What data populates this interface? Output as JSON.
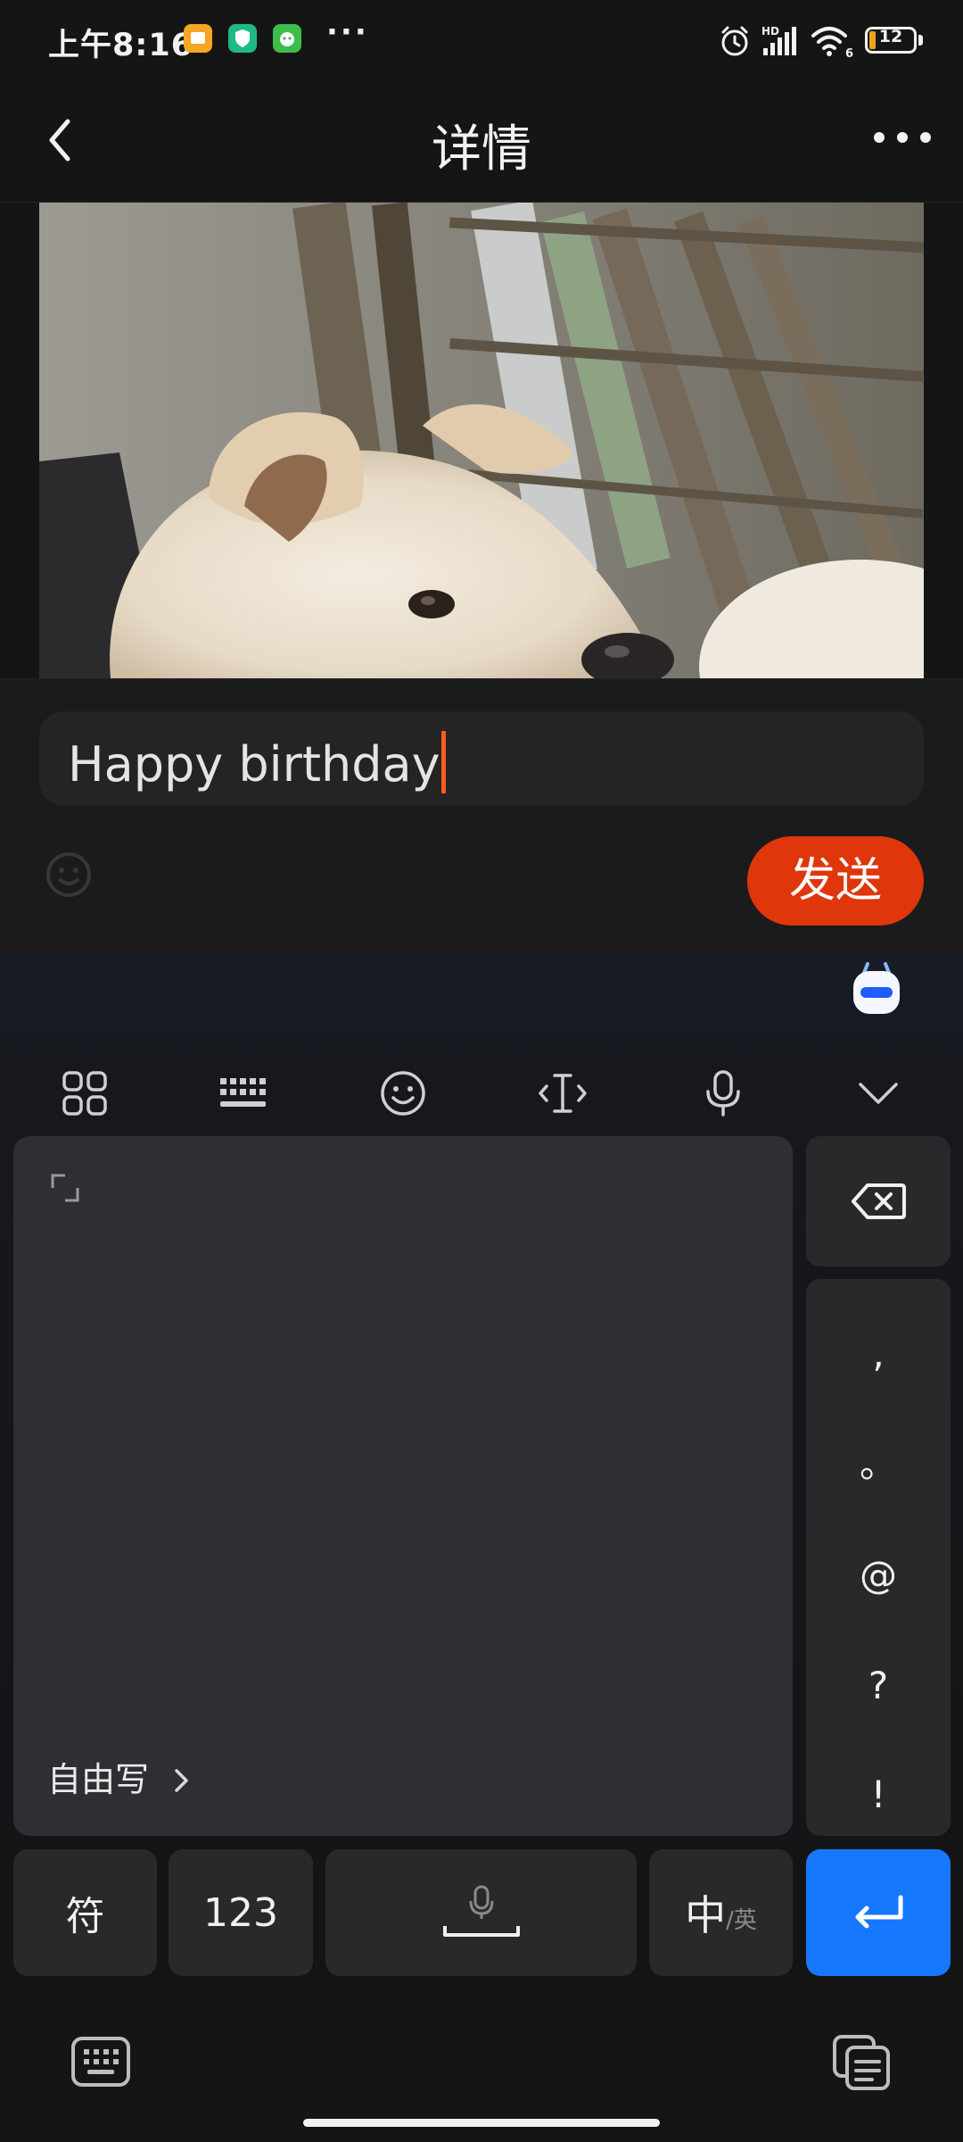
{
  "status_bar": {
    "time": "上午8:16",
    "more": "···",
    "battery": "12",
    "network_badge": "HD",
    "wifi_badge": "6"
  },
  "header": {
    "title": "详情"
  },
  "comment": {
    "input_value": "Happy birthday",
    "send_label": "发送"
  },
  "keyboard": {
    "freewrite_label": "自由写",
    "punctuation": [
      ",",
      "。",
      "@",
      "?",
      "!"
    ],
    "symbols_key": "符",
    "numbers_key": "123",
    "lang_key_main": "中",
    "lang_key_sub": "/英"
  },
  "colors": {
    "accent_send": "#e0360b",
    "enter_key": "#1677ff",
    "caret": "#ff5a1f"
  }
}
